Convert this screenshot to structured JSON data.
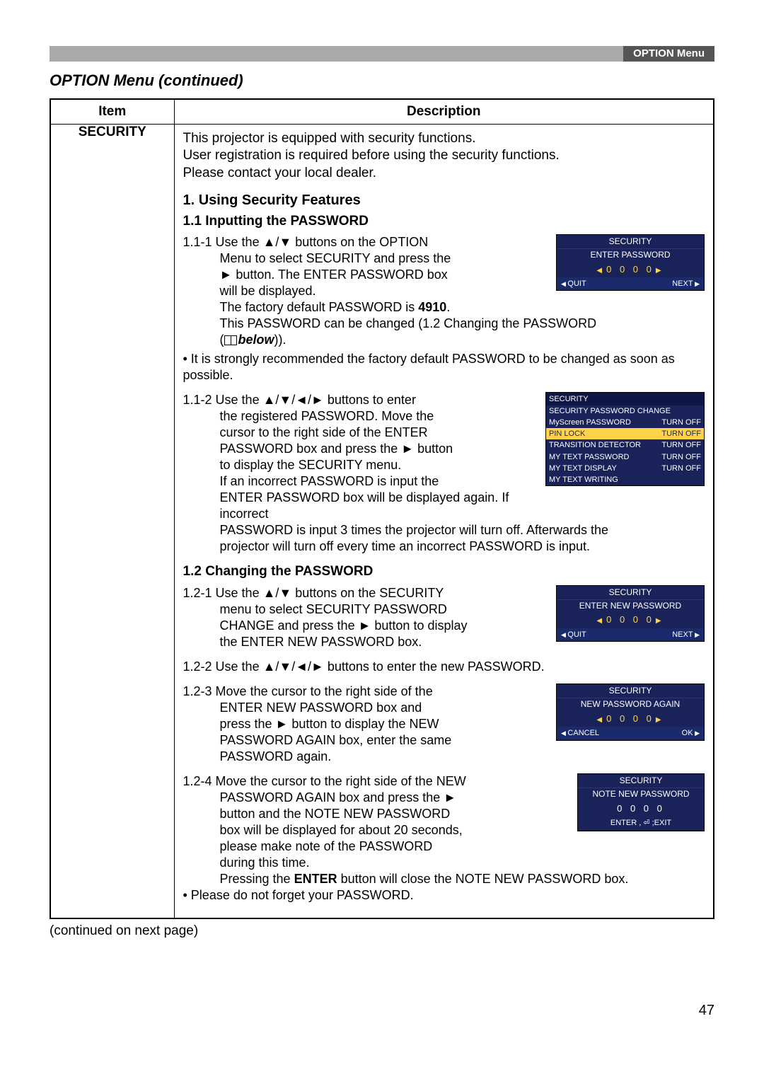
{
  "header": {
    "tab_label": "OPTION Menu"
  },
  "section_title": "OPTION Menu (continued)",
  "table": {
    "head_item": "Item",
    "head_desc": "Description",
    "item_label": "SECURITY"
  },
  "intro": [
    "This projector is equipped with security functions.",
    "User registration is required before using the security functions.",
    "Please contact your local dealer."
  ],
  "h1": "1. Using Security Features",
  "h2a": "1.1 Inputting the PASSWORD",
  "steps_11": [
    {
      "num": "1.1-1",
      "lines": [
        "Use the ▲/▼ buttons on the OPTION",
        "Menu to select SECURITY and press the",
        "► button. The ENTER PASSWORD box",
        "will be displayed.",
        "The factory default PASSWORD is 4910.",
        "This PASSWORD can be changed (1.2 Changing the PASSWORD"
      ],
      "below": "below",
      "bullet": "• It is strongly recommended the factory default PASSWORD to be changed as soon as possible.",
      "bold_index": 4,
      "bold_word": "4910"
    },
    {
      "num": "1.1-2",
      "lines": [
        "Use the ▲/▼/◄/► buttons to enter",
        "the registered PASSWORD. Move the",
        "cursor to the right side of the ENTER",
        "PASSWORD box and press the ► button",
        "to display the SECURITY menu.",
        "If an incorrect PASSWORD is input the",
        "ENTER PASSWORD box will be displayed again. If incorrect",
        "PASSWORD is input 3 times the projector will turn off. Afterwards the",
        "projector will turn off every time an incorrect PASSWORD is input."
      ]
    }
  ],
  "h2b": "1.2 Changing the PASSWORD",
  "steps_12": [
    {
      "num": "1.2-1",
      "lines": [
        "Use the ▲/▼ buttons on the SECURITY",
        "menu to select SECURITY PASSWORD",
        "CHANGE and press the ► button to display",
        "the ENTER NEW PASSWORD box."
      ]
    },
    {
      "num": "1.2-2",
      "text": "Use the ▲/▼/◄/► buttons to enter the new PASSWORD."
    },
    {
      "num": "1.2-3",
      "lines": [
        "Move the cursor to the right side of the",
        "ENTER NEW PASSWORD box and",
        "press the ► button to display the NEW",
        "PASSWORD AGAIN box, enter the same",
        "PASSWORD again."
      ]
    },
    {
      "num": "1.2-4",
      "lines": [
        "Move the cursor to the right side of the NEW",
        "PASSWORD AGAIN box and press the ►",
        "button and the NOTE NEW PASSWORD",
        "box will be displayed for about 20 seconds,",
        "please make note of the PASSWORD",
        "during this time.",
        "Pressing the ENTER button will close the NOTE NEW PASSWORD box."
      ],
      "bold_in": "ENTER",
      "bullet": "• Please do not forget your PASSWORD."
    }
  ],
  "osd_boxes": {
    "enter_pw": {
      "title": "SECURITY",
      "sub": "ENTER PASSWORD",
      "digits": "0 0 0 0",
      "left": "QUIT",
      "right": "NEXT"
    },
    "menu": {
      "title": "SECURITY",
      "rows": [
        {
          "l": "SECURITY PASSWORD CHANGE",
          "r": ""
        },
        {
          "l": "MyScreen PASSWORD",
          "r": "TURN OFF"
        },
        {
          "l": "PIN LOCK",
          "r": "TURN OFF",
          "hl": true
        },
        {
          "l": "TRANSITION DETECTOR",
          "r": "TURN OFF"
        },
        {
          "l": "MY TEXT PASSWORD",
          "r": "TURN OFF"
        },
        {
          "l": "MY TEXT DISPLAY",
          "r": "TURN OFF"
        },
        {
          "l": "MY TEXT WRITING",
          "r": ""
        }
      ]
    },
    "enter_new": {
      "title": "SECURITY",
      "sub": "ENTER NEW PASSWORD",
      "digits": "0 0 0 0",
      "left": "QUIT",
      "right": "NEXT"
    },
    "again": {
      "title": "SECURITY",
      "sub": "NEW PASSWORD AGAIN",
      "digits": "0 0 0 0",
      "left": "CANCEL",
      "right": "OK"
    },
    "note": {
      "title": "SECURITY",
      "sub": "NOTE NEW PASSWORD",
      "digits": "0 0 0 0",
      "foot": "ENTER , ⏎ ;EXIT"
    }
  },
  "continued": "(continued on next page)",
  "page_number": "47"
}
